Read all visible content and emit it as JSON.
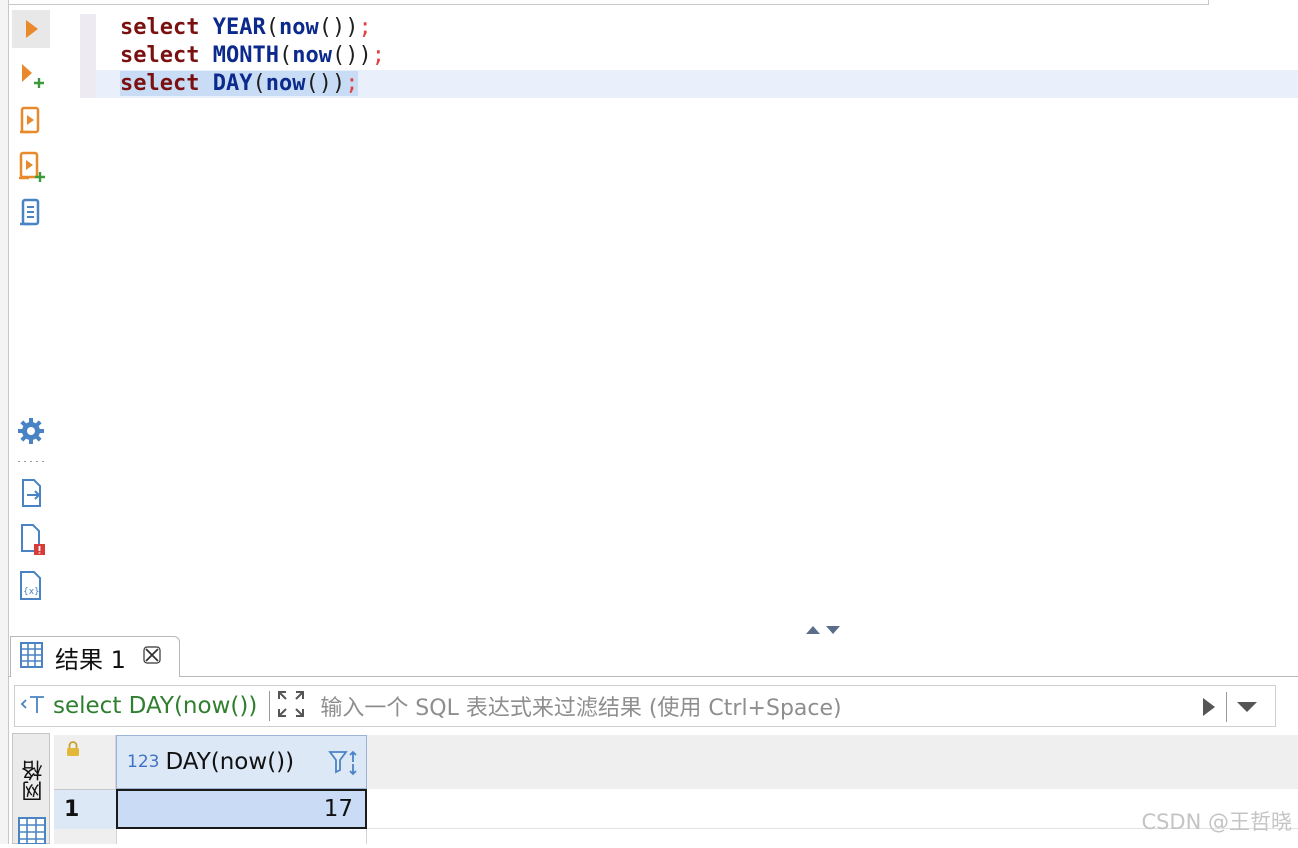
{
  "editor": {
    "lines": [
      {
        "keyword": "select",
        "function": "YEAR",
        "open": "(",
        "inner": "now",
        "inner_parens": "()",
        "close": ")",
        "semicolon": ";"
      },
      {
        "keyword": "select",
        "function": "MONTH",
        "open": "(",
        "inner": "now",
        "inner_parens": "()",
        "close": ")",
        "semicolon": ";"
      },
      {
        "keyword": "select",
        "function": "DAY",
        "open": "(",
        "inner": "now",
        "inner_parens": "()",
        "close": ")",
        "semicolon": ";"
      }
    ],
    "toolbar_icons": [
      "execute-statement-icon",
      "execute-in-new-tab-icon",
      "execute-script-icon",
      "execute-script-new-tab-icon",
      "explain-plan-icon"
    ],
    "side_icons": [
      "settings-gear-icon",
      "export-file-icon",
      "problems-file-icon",
      "variables-file-icon"
    ]
  },
  "results": {
    "tab_label": "结果 1",
    "filter": {
      "query": "select DAY(now())",
      "placeholder": "输入一个 SQL 表达式来过滤结果 (使用 Ctrl+Space)"
    },
    "view_tab_label": "网格",
    "column": {
      "type_badge": "123",
      "name": "DAY(now())"
    },
    "rows": [
      {
        "num": "1",
        "value": "17"
      }
    ]
  },
  "watermark": "CSDN @王哲晓",
  "colors": {
    "keyword": "#7a1010",
    "function": "#0b2a8c",
    "semicolon": "#e04040",
    "toolbar_orange": "#e8892b",
    "icon_blue": "#4a83c4",
    "filter_query": "#2f7f2f",
    "selection": "#c9dbf5"
  }
}
